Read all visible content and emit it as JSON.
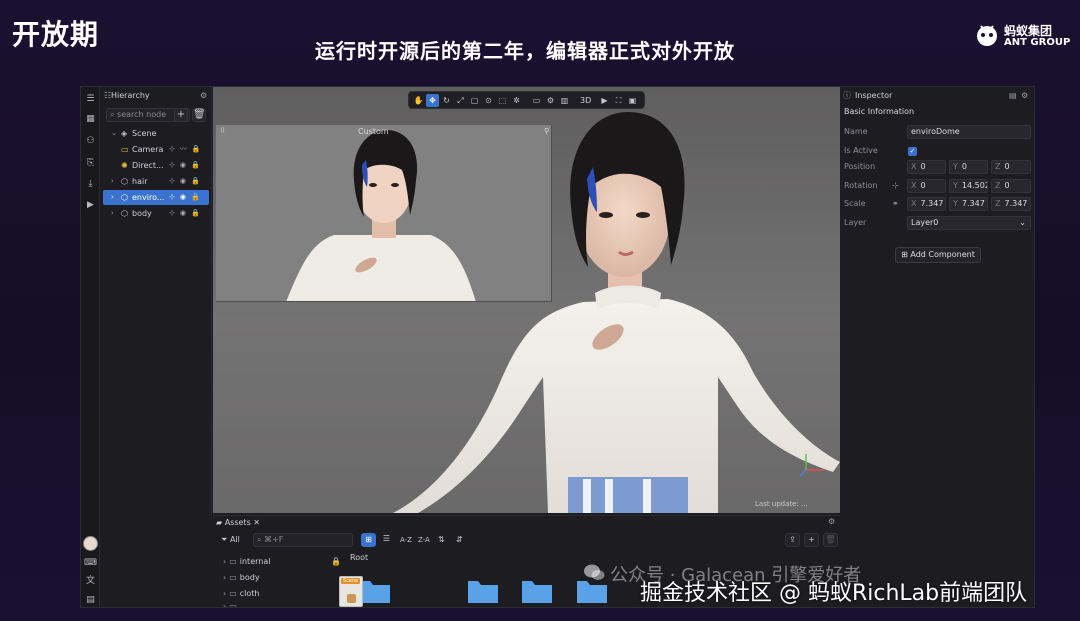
{
  "slide": {
    "title": "开放期",
    "subtitle": "运行时开源后的第二年，编辑器正式对外开放",
    "logo_cn": "蚂蚁集团",
    "logo_en": "ANT GROUP"
  },
  "hierarchy": {
    "title": "Hierarchy",
    "search_placeholder": "search node",
    "add_label": "+",
    "delete_label": "🗑",
    "nodes": [
      {
        "label": "Scene",
        "icon": "scene-icon"
      },
      {
        "label": "Camera",
        "icon": "camera-icon"
      },
      {
        "label": "Direct...",
        "icon": "light-icon"
      },
      {
        "label": "hair",
        "icon": "cube-icon"
      },
      {
        "label": "enviro...",
        "icon": "cube-icon",
        "selected": true
      },
      {
        "label": "body",
        "icon": "cube-icon"
      }
    ]
  },
  "viewport": {
    "mode_3d": "3D",
    "pip_label": "Custom",
    "last_updated": "Last update: ..."
  },
  "inspector": {
    "title": "Inspector",
    "section": "Basic Information",
    "name_label": "Name",
    "name_value": "enviroDome",
    "active_label": "Is Active",
    "position_label": "Position",
    "position": {
      "x": "0",
      "y": "0",
      "z": "0"
    },
    "rotation_label": "Rotation",
    "rotation": {
      "x": "0",
      "y": "14.502",
      "z": "0"
    },
    "scale_label": "Scale",
    "scale": {
      "x": "7.347",
      "y": "7.347",
      "z": "7.347"
    },
    "layer_label": "Layer",
    "layer_value": "Layer0",
    "add_component": "Add Component"
  },
  "assets": {
    "title": "Assets",
    "filter_all": "All",
    "search_placeholder": "⌘+F",
    "sort_az": "A-Z",
    "sort_za": "Z-A",
    "root_label": "Root",
    "folders": [
      "internal",
      "body",
      "cloth",
      "..."
    ],
    "scene_tag": "Scene"
  },
  "watermark": {
    "line1": "公众号 · Galacean 引擎爱好者",
    "line2": "掘金技术社区 @ 蚂蚁RichLab前端团队"
  }
}
